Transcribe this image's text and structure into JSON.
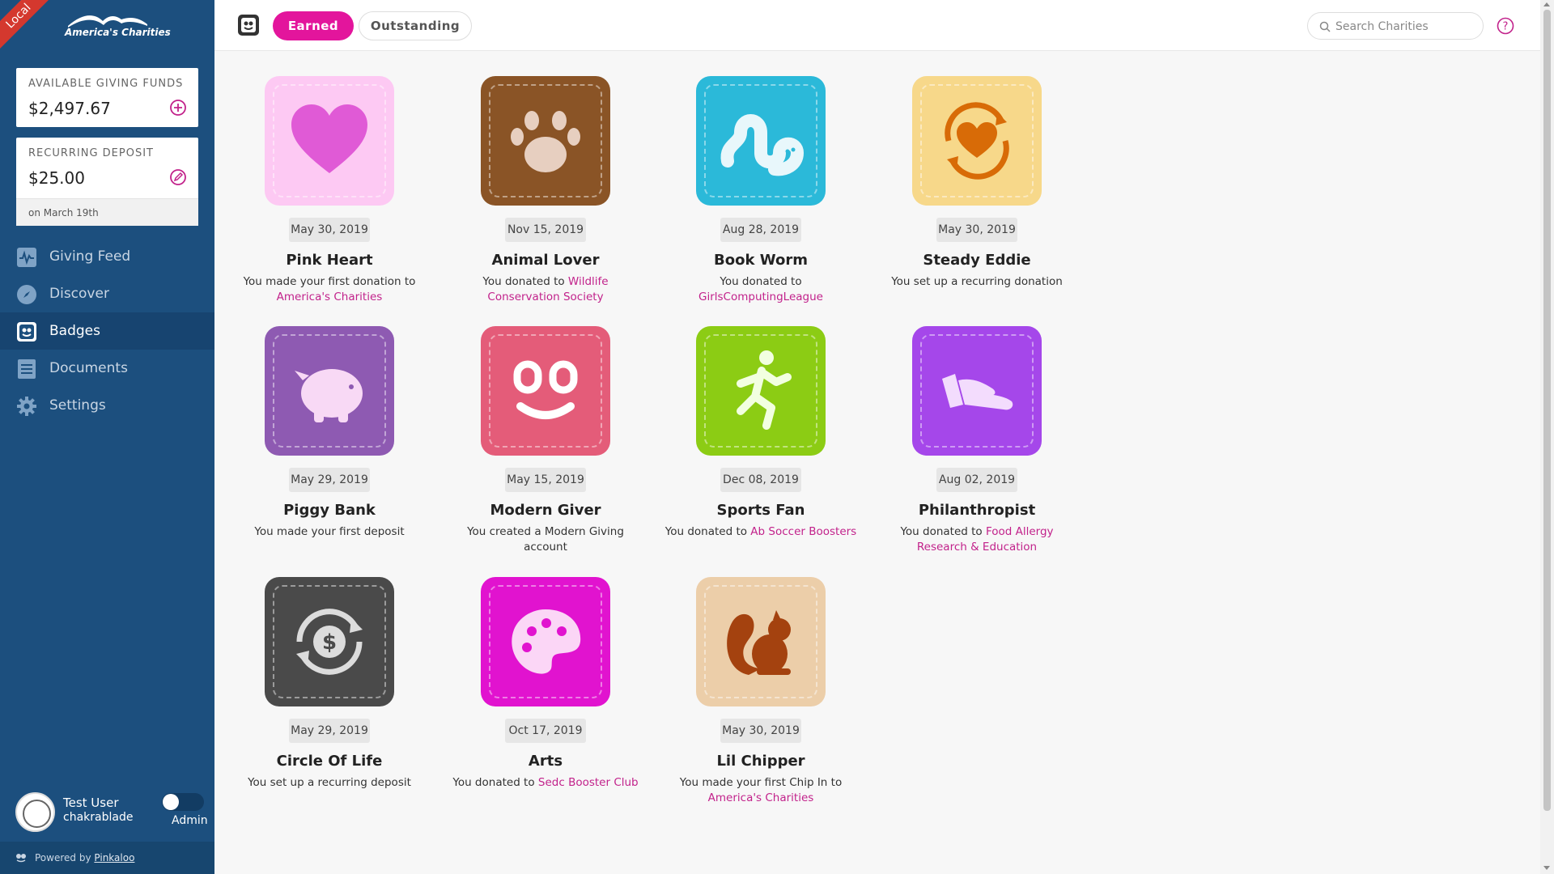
{
  "env_label": "Local",
  "brand": {
    "name": "America's Charities"
  },
  "funds": {
    "available": {
      "label": "AVAILABLE GIVING FUNDS",
      "value": "$2,497.67"
    },
    "recurring": {
      "label": "RECURRING DEPOSIT",
      "value": "$25.00",
      "note": "on March 19th"
    }
  },
  "nav": [
    {
      "label": "Giving Feed",
      "icon": "pulse-icon"
    },
    {
      "label": "Discover",
      "icon": "compass-icon"
    },
    {
      "label": "Badges",
      "icon": "badge-icon",
      "active": true
    },
    {
      "label": "Documents",
      "icon": "document-icon"
    },
    {
      "label": "Settings",
      "icon": "gear-icon"
    }
  ],
  "user": {
    "name": "Test User",
    "handle": "chakrablade",
    "role_label": "Admin"
  },
  "footer": {
    "prefix": "Powered by",
    "link": "Pinkaloo"
  },
  "tabs": {
    "earned": "Earned",
    "outstanding": "Outstanding",
    "active": "earned"
  },
  "search": {
    "placeholder": "Search Charities"
  },
  "colors": {
    "sidebar": "#1c4f7e",
    "accent": "#e3159c",
    "link": "#c2228b"
  },
  "badges": [
    {
      "title": "Pink Heart",
      "date": "May 30, 2019",
      "text": "You made your first donation to",
      "link": "America's Charities",
      "icon": "heart-icon",
      "color": "#fdc9f3"
    },
    {
      "title": "Animal Lover",
      "date": "Nov 15, 2019",
      "text": "You donated to",
      "link": "Wildlife Conservation Society",
      "icon": "paw-icon",
      "color": "#8a5426"
    },
    {
      "title": "Book Worm",
      "date": "Aug 28, 2019",
      "text": "You donated to",
      "link": "GirlsComputingLeague",
      "icon": "worm-icon",
      "color": "#2bb9d9"
    },
    {
      "title": "Steady Eddie",
      "date": "May 30, 2019",
      "text": "You set up a recurring donation",
      "link": "",
      "icon": "recurring-heart-icon",
      "color": "#f7d88a"
    },
    {
      "title": "Piggy Bank",
      "date": "May 29, 2019",
      "text": "You made your first deposit",
      "link": "",
      "icon": "piggy-bank-icon",
      "color": "#8e5ab2"
    },
    {
      "title": "Modern Giver",
      "date": "May 15, 2019",
      "text": "You created a Modern Giving account",
      "link": "",
      "icon": "smiley-icon",
      "color": "#e45c79"
    },
    {
      "title": "Sports Fan",
      "date": "Dec 08, 2019",
      "text": "You donated to",
      "link": "Ab Soccer Boosters",
      "icon": "runner-icon",
      "color": "#8ccc14"
    },
    {
      "title": "Philanthropist",
      "date": "Aug 02, 2019",
      "text": "You donated to",
      "link": "Food Allergy Research & Education",
      "icon": "giving-hand-icon",
      "color": "#a547ea"
    },
    {
      "title": "Circle Of Life",
      "date": "May 29, 2019",
      "text": "You set up a recurring deposit",
      "link": "",
      "icon": "dollar-cycle-icon",
      "color": "#4a4a4a"
    },
    {
      "title": "Arts",
      "date": "Oct 17, 2019",
      "text": "You donated to",
      "link": "Sedc Booster Club",
      "icon": "palette-icon",
      "color": "#e113cf"
    },
    {
      "title": "Lil Chipper",
      "date": "May 30, 2019",
      "text": "You made your first Chip In to",
      "link": "America's Charities",
      "icon": "squirrel-icon",
      "color": "#eccea9"
    }
  ]
}
